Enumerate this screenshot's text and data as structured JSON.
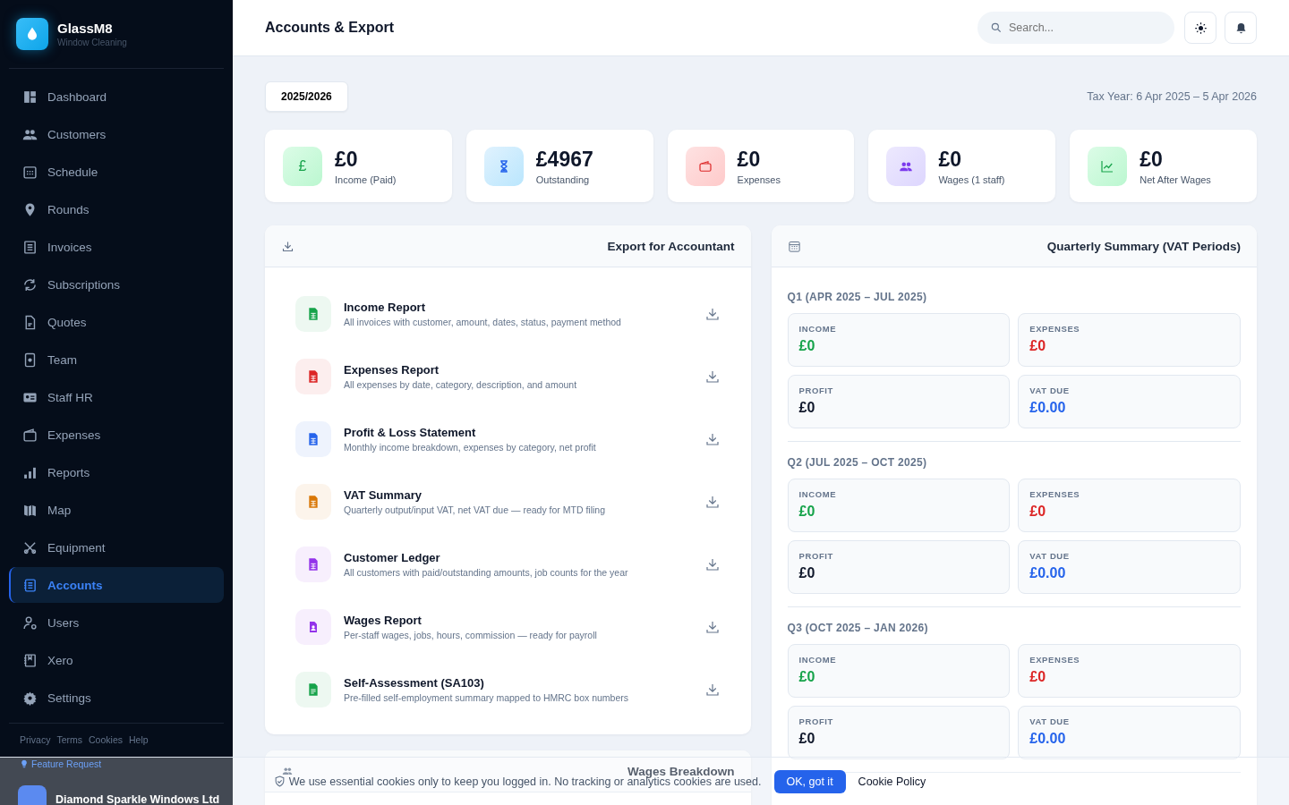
{
  "brand": {
    "name": "GlassM8",
    "tagline": "Window Cleaning"
  },
  "sidebar": {
    "items": [
      {
        "label": "Dashboard",
        "selected": false
      },
      {
        "label": "Customers",
        "selected": false
      },
      {
        "label": "Schedule",
        "selected": false
      },
      {
        "label": "Rounds",
        "selected": false
      },
      {
        "label": "Invoices",
        "selected": false
      },
      {
        "label": "Subscriptions",
        "selected": false
      },
      {
        "label": "Quotes",
        "selected": false
      },
      {
        "label": "Team",
        "selected": false
      },
      {
        "label": "Staff HR",
        "selected": false
      },
      {
        "label": "Expenses",
        "selected": false
      },
      {
        "label": "Reports",
        "selected": false
      },
      {
        "label": "Map",
        "selected": false
      },
      {
        "label": "Equipment",
        "selected": false
      },
      {
        "label": "Accounts",
        "selected": true
      },
      {
        "label": "Users",
        "selected": false
      },
      {
        "label": "Xero",
        "selected": false
      },
      {
        "label": "Settings",
        "selected": false
      }
    ],
    "footer_links": [
      "Privacy",
      "Terms",
      "Cookies",
      "Help"
    ],
    "feature_request": "Feature Request",
    "account": {
      "name": "Diamond Sparkle Windows Ltd"
    }
  },
  "header": {
    "title": "Accounts & Export",
    "search": {
      "placeholder": "Search..."
    }
  },
  "year_button": "2025/2026",
  "tax_year": "Tax Year: 6 Apr 2025 – 5 Apr 2026",
  "stats": [
    {
      "value": "£0",
      "label": "Income (Paid)",
      "kind": "income",
      "glyph": "£"
    },
    {
      "value": "£4967",
      "label": "Outstanding",
      "kind": "outstanding"
    },
    {
      "value": "£0",
      "label": "Expenses",
      "kind": "expenses"
    },
    {
      "value": "£0",
      "label": "Wages (1 staff)",
      "kind": "wages"
    },
    {
      "value": "£0",
      "label": "Net After Wages",
      "kind": "net"
    }
  ],
  "export": {
    "title": "Export for Accountant",
    "reports": [
      {
        "title": "Income Report",
        "description": "All invoices with customer, amount, dates, status, payment method",
        "color": "#16a34a"
      },
      {
        "title": "Expenses Report",
        "description": "All expenses by date, category, description, and amount",
        "color": "#dc2626"
      },
      {
        "title": "Profit & Loss Statement",
        "description": "Monthly income breakdown, expenses by category, net profit",
        "color": "#2563eb"
      },
      {
        "title": "VAT Summary",
        "description": "Quarterly output/input VAT, net VAT due — ready for MTD filing",
        "color": "#d97706"
      },
      {
        "title": "Customer Ledger",
        "description": "All customers with paid/outstanding amounts, job counts for the year",
        "color": "#9333ea"
      },
      {
        "title": "Wages Report",
        "description": "Per-staff wages, jobs, hours, commission — ready for payroll",
        "color": "#9333ea"
      },
      {
        "title": "Self-Assessment (SA103)",
        "description": "Pre-filled self-employment summary mapped to HMRC box numbers",
        "color": "#16a34a"
      }
    ]
  },
  "quarterly": {
    "title": "Quarterly Summary (VAT Periods)",
    "quarters": [
      {
        "label": "Q1 (APR 2025 – JUL 2025)",
        "tiles": [
          {
            "kind": "income",
            "label": "INCOME",
            "value": "£0"
          },
          {
            "kind": "expenses",
            "label": "EXPENSES",
            "value": "£0"
          },
          {
            "kind": "profit",
            "label": "PROFIT",
            "value": "£0"
          },
          {
            "kind": "vat",
            "label": "VAT DUE",
            "value": "£0.00"
          }
        ]
      },
      {
        "label": "Q2 (JUL 2025 – OCT 2025)",
        "tiles": [
          {
            "kind": "income",
            "label": "INCOME",
            "value": "£0"
          },
          {
            "kind": "expenses",
            "label": "EXPENSES",
            "value": "£0"
          },
          {
            "kind": "profit",
            "label": "PROFIT",
            "value": "£0"
          },
          {
            "kind": "vat",
            "label": "VAT DUE",
            "value": "£0.00"
          }
        ]
      },
      {
        "label": "Q3 (OCT 2025 – JAN 2026)",
        "tiles": [
          {
            "kind": "income",
            "label": "INCOME",
            "value": "£0"
          },
          {
            "kind": "expenses",
            "label": "EXPENSES",
            "value": "£0"
          },
          {
            "kind": "profit",
            "label": "PROFIT",
            "value": "£0"
          },
          {
            "kind": "vat",
            "label": "VAT DUE",
            "value": "£0.00"
          }
        ]
      }
    ]
  },
  "wages": {
    "title": "Wages Breakdown"
  },
  "cookie_banner": {
    "text": "We use essential cookies only to keep you logged in. No tracking or analytics cookies are used.",
    "button": "OK, got it",
    "link": "Cookie Policy"
  }
}
